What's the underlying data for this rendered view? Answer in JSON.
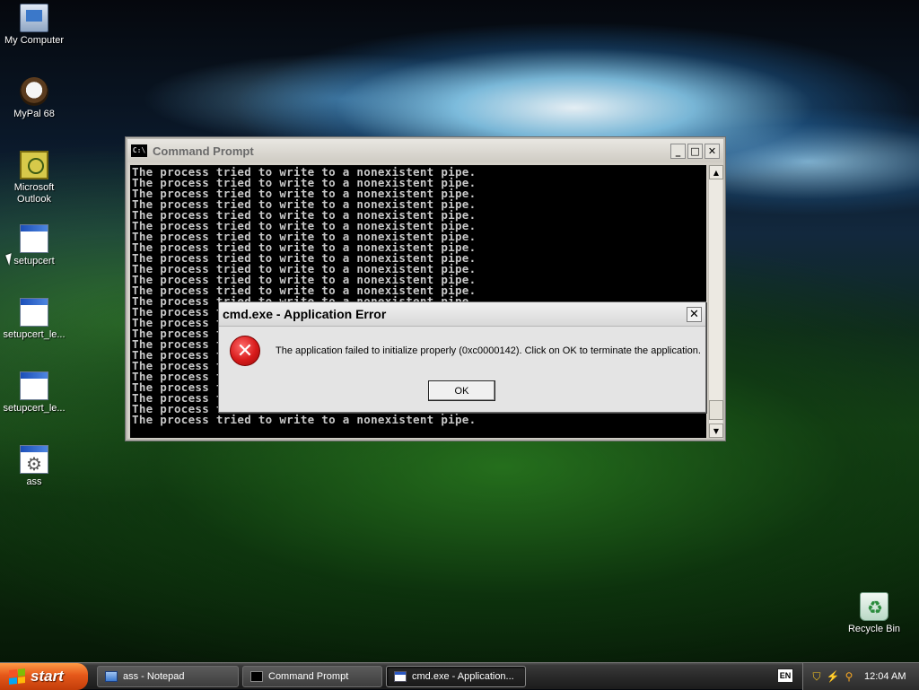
{
  "desktop": {
    "icons": [
      {
        "label": "My Computer",
        "icon": "computer-icon"
      },
      {
        "label": "MyPal 68",
        "icon": "browser-icon"
      },
      {
        "label": "Microsoft Outlook",
        "icon": "outlook-icon"
      },
      {
        "label": "setupcert",
        "icon": "program-icon"
      },
      {
        "label": "setupcert_le...",
        "icon": "program-icon"
      },
      {
        "label": "setupcert_le...",
        "icon": "program-icon"
      },
      {
        "label": "ass",
        "icon": "gear-icon"
      }
    ],
    "recycle_bin": {
      "label": "Recycle Bin",
      "icon": "recycle-bin-icon"
    }
  },
  "cmd_window": {
    "title": "Command Prompt",
    "icon_text": "C:\\",
    "line_text": "The process tried to write to a nonexistent pipe.",
    "line_count": 24,
    "controls": {
      "minimize": "_",
      "maximize": "□",
      "close": "✕"
    }
  },
  "error_dialog": {
    "title": "cmd.exe - Application Error",
    "message": "The application failed to initialize properly (0xc0000142). Click on OK to terminate the application.",
    "ok_label": "OK",
    "close": "✕"
  },
  "taskbar": {
    "start_label": "start",
    "tasks": [
      {
        "label": "ass - Notepad",
        "icon": "notepad-icon",
        "active": false
      },
      {
        "label": "Command Prompt",
        "icon": "cmd-icon",
        "active": false
      },
      {
        "label": "cmd.exe - Application...",
        "icon": "window-icon",
        "active": true
      }
    ],
    "language": "EN",
    "clock": "12:04 AM"
  }
}
